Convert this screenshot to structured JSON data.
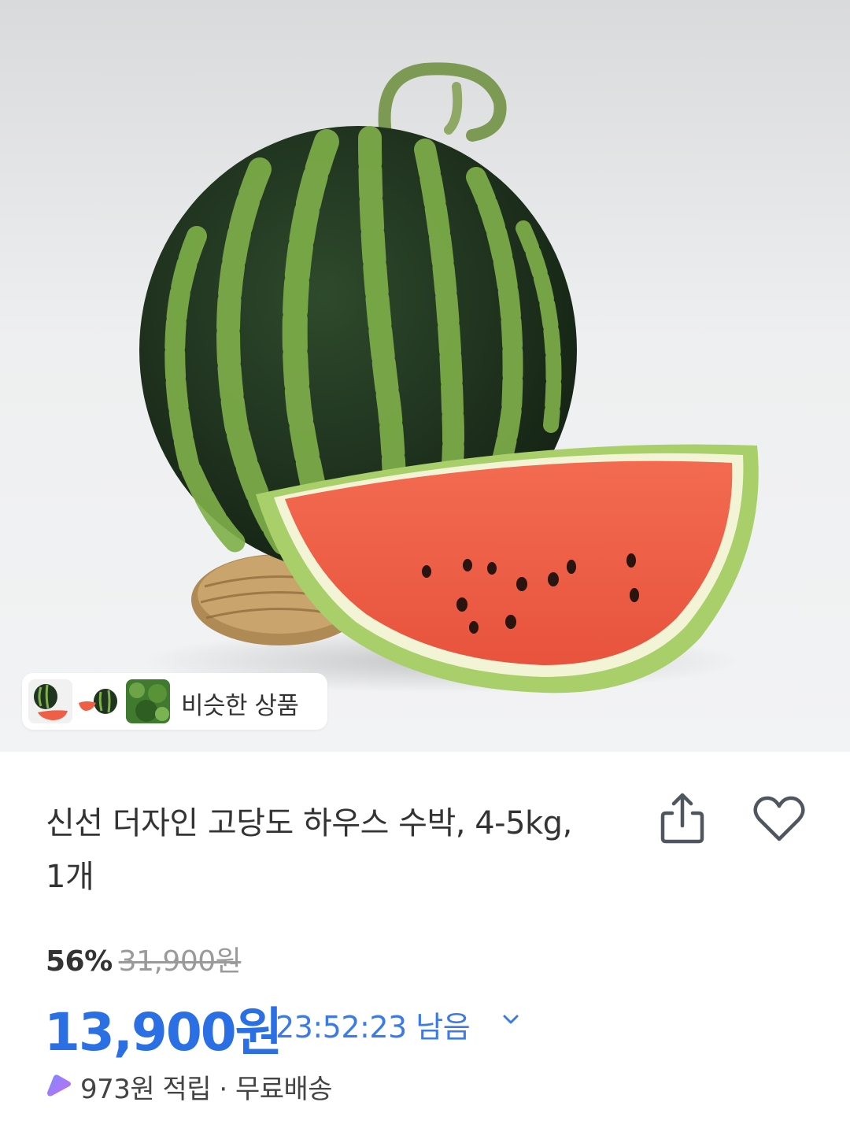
{
  "similar_chip": {
    "label": "비슷한 상품"
  },
  "product": {
    "title": "신선 더자인 고당도 하우스 수박, 4-5kg, 1개",
    "discount_rate": "56%",
    "original_price": "31,900원",
    "sale_price": "13,900원",
    "timer_text": "23:52:23 남음",
    "reward_text": "973원 적립 · 무료배송"
  },
  "colors": {
    "price_blue": "#2b6fe5",
    "text_dark": "#333333",
    "strike_gray": "#9a9a9a"
  },
  "icons": {
    "share": "share-icon",
    "heart": "heart-icon",
    "chevron": "chevron-down-icon",
    "reward": "reward-icon"
  }
}
